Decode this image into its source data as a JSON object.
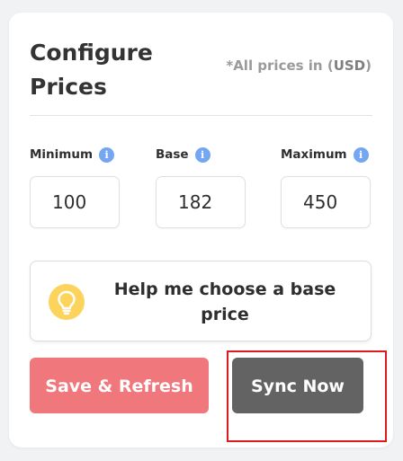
{
  "card": {
    "title": "Configure Prices",
    "price_note_prefix": "*All prices in (",
    "price_note_currency": "USD",
    "price_note_suffix": ")"
  },
  "fields": [
    {
      "label": "Minimum",
      "value": "100",
      "icon": "info-icon"
    },
    {
      "label": "Base",
      "value": "182",
      "icon": "info-icon"
    },
    {
      "label": "Maximum",
      "value": "450",
      "icon": "info-icon"
    }
  ],
  "help": {
    "icon": "lightbulb-icon",
    "text": "Help me choose a base price"
  },
  "buttons": {
    "save_label": "Save & Refresh",
    "sync_label": "Sync Now"
  },
  "colors": {
    "info_icon": "#74a6f2",
    "lightbulb": "#fcd45c",
    "save_button": "#f0777c",
    "sync_button": "#636363",
    "highlight_border": "#e0191c"
  }
}
